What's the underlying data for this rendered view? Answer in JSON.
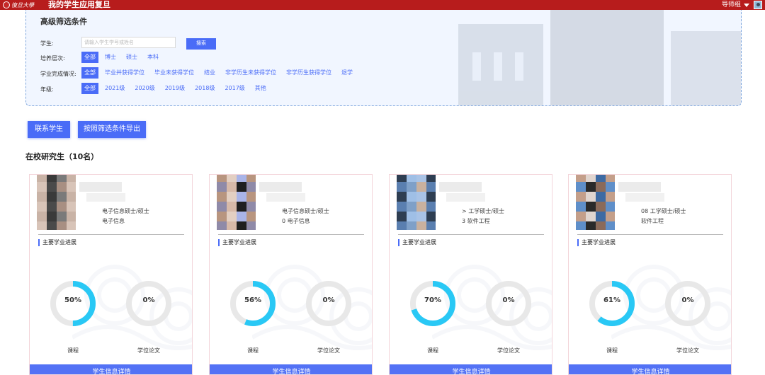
{
  "header": {
    "logo_text": "復旦大學",
    "app_title": "我的学生应用复旦",
    "role": "导师组"
  },
  "filter": {
    "title": "高级筛选条件",
    "student_label": "学生:",
    "search_placeholder": "请输入学生学号或姓名",
    "search_button": "搜索",
    "level_label": "培养层次:",
    "levels": [
      "全部",
      "博士",
      "硕士",
      "本科"
    ],
    "status_label": "学业完成情况:",
    "statuses": [
      "全部",
      "毕业并获得学位",
      "毕业未获得学位",
      "结业",
      "非学历生未获得学位",
      "非学历生获得学位",
      "退学"
    ],
    "grade_label": "年级:",
    "grades": [
      "全部",
      "2021级",
      "2020级",
      "2019级",
      "2018级",
      "2017级",
      "其他"
    ]
  },
  "actions": {
    "contact": "联系学生",
    "export": "按照筛选条件导出"
  },
  "section_title": "在校研究生（10名）",
  "progress_title": "主要学业进展",
  "course_caption": "课程",
  "thesis_caption": "学位论文",
  "detail_button": "学生信息详情",
  "students": [
    {
      "major_line1": "电子信息硕士/硕士",
      "major_line2": "电子信息",
      "course_progress": "50%",
      "course_value": 0.5,
      "thesis_progress": "0%",
      "thesis_value": 0
    },
    {
      "major_line1": "电子信息硕士/硕士",
      "major_line2": "0 电子信息",
      "course_progress": "56%",
      "course_value": 0.56,
      "thesis_progress": "0%",
      "thesis_value": 0
    },
    {
      "major_line1": "> 工学硕士/硕士",
      "major_line2": "3 软件工程",
      "course_progress": "70%",
      "course_value": 0.7,
      "thesis_progress": "0%",
      "thesis_value": 0
    },
    {
      "major_line1": "08 工学硕士/硕士",
      "major_line2": "软件工程",
      "course_progress": "61%",
      "course_value": 0.61,
      "thesis_progress": "0%",
      "thesis_value": 0
    }
  ],
  "colors": {
    "topbar": "#b71c1c",
    "accent": "#4a6cf7",
    "donut_fill": "#29c8f5",
    "donut_track": "#e8e8e8"
  }
}
